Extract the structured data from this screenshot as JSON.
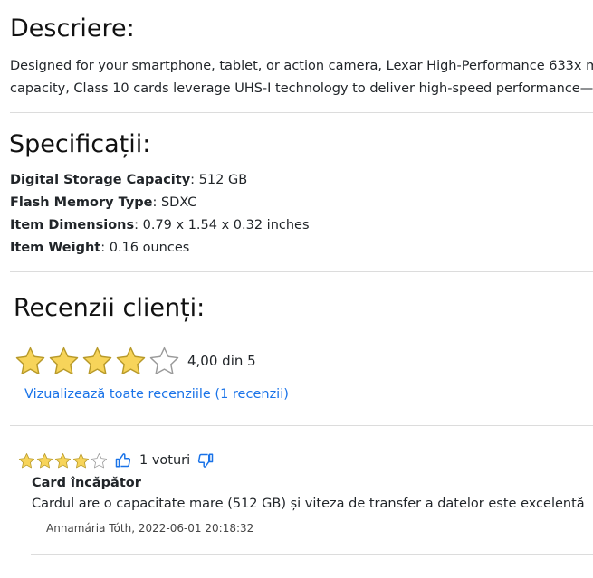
{
  "description": {
    "title": "Descriere:",
    "line1": "Designed for your smartphone, tablet, or action camera, Lexar High-Performance 633x m",
    "line2": "capacity, Class 10 cards leverage UHS-I technology to deliver high-speed performance—"
  },
  "specifications": {
    "title": "Specificații:",
    "items": [
      {
        "label": "Digital Storage Capacity",
        "value": ": 512 GB"
      },
      {
        "label": "Flash Memory Type",
        "value": ": SDXC"
      },
      {
        "label": "Item Dimensions",
        "value": ": 0.79 x 1.54 x 0.32 inches"
      },
      {
        "label": "Item Weight",
        "value": ": 0.16 ounces"
      }
    ]
  },
  "reviews": {
    "title": "Recenzii clienți:",
    "rating_value": 4,
    "rating_max": 5,
    "rating_text": "4,00 din 5",
    "all_reviews_link": "Vizualizează toate recenziile (1 recenzii)",
    "items": [
      {
        "stars": 4,
        "votes": "1 voturi",
        "title": "Card încăpător",
        "body": "Cardul are o capacitate mare (512 GB) și viteza de transfer a datelor este excelentă",
        "author_date": "Annamária Tóth, 2022-06-01 20:18:32"
      }
    ]
  },
  "colors": {
    "star_fill": "#f7d45a",
    "star_stroke": "#b89a2a",
    "star_empty_stroke": "#9a9a9a",
    "link": "#1a73e8",
    "thumb_up": "#1a73e8",
    "thumb_down": "#1a73e8",
    "divider": "#dcdcdc"
  }
}
